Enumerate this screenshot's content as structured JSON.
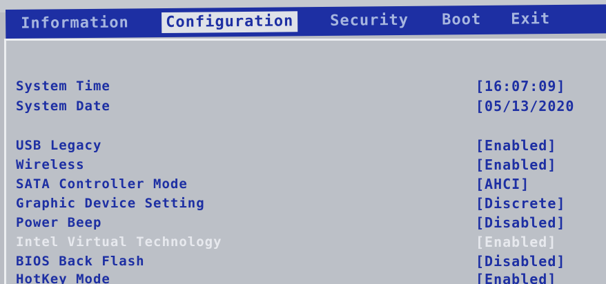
{
  "tabs": {
    "information": "Information",
    "configuration": "Configuration",
    "security": "Security",
    "boot": "Boot",
    "exit": "Exit"
  },
  "active_tab": "Configuration",
  "settings": [
    {
      "label": "System Time",
      "value": "[16:07:09]"
    },
    {
      "label": "System Date",
      "value": "[05/13/2020"
    },
    {
      "label": "USB Legacy",
      "value": "[Enabled]"
    },
    {
      "label": "Wireless",
      "value": "[Enabled]"
    },
    {
      "label": "SATA Controller Mode",
      "value": "[AHCI]"
    },
    {
      "label": "Graphic Device Setting",
      "value": "[Discrete]"
    },
    {
      "label": "Power Beep",
      "value": "[Disabled]"
    },
    {
      "label": "Intel Virtual Technology",
      "value": "[Enabled]"
    },
    {
      "label": "BIOS Back Flash",
      "value": "[Disabled]"
    },
    {
      "label": "HotKey Mode",
      "value": "[Enabled]"
    }
  ],
  "colors": {
    "menu_bar": "#1d2fa3",
    "menu_text": "#a7b6df",
    "active_tab_bg": "#dfe2e8",
    "panel_bg": "#bcc0c7",
    "setting_text": "#1d2fa3",
    "greyed_text": "#e7e9ee"
  }
}
